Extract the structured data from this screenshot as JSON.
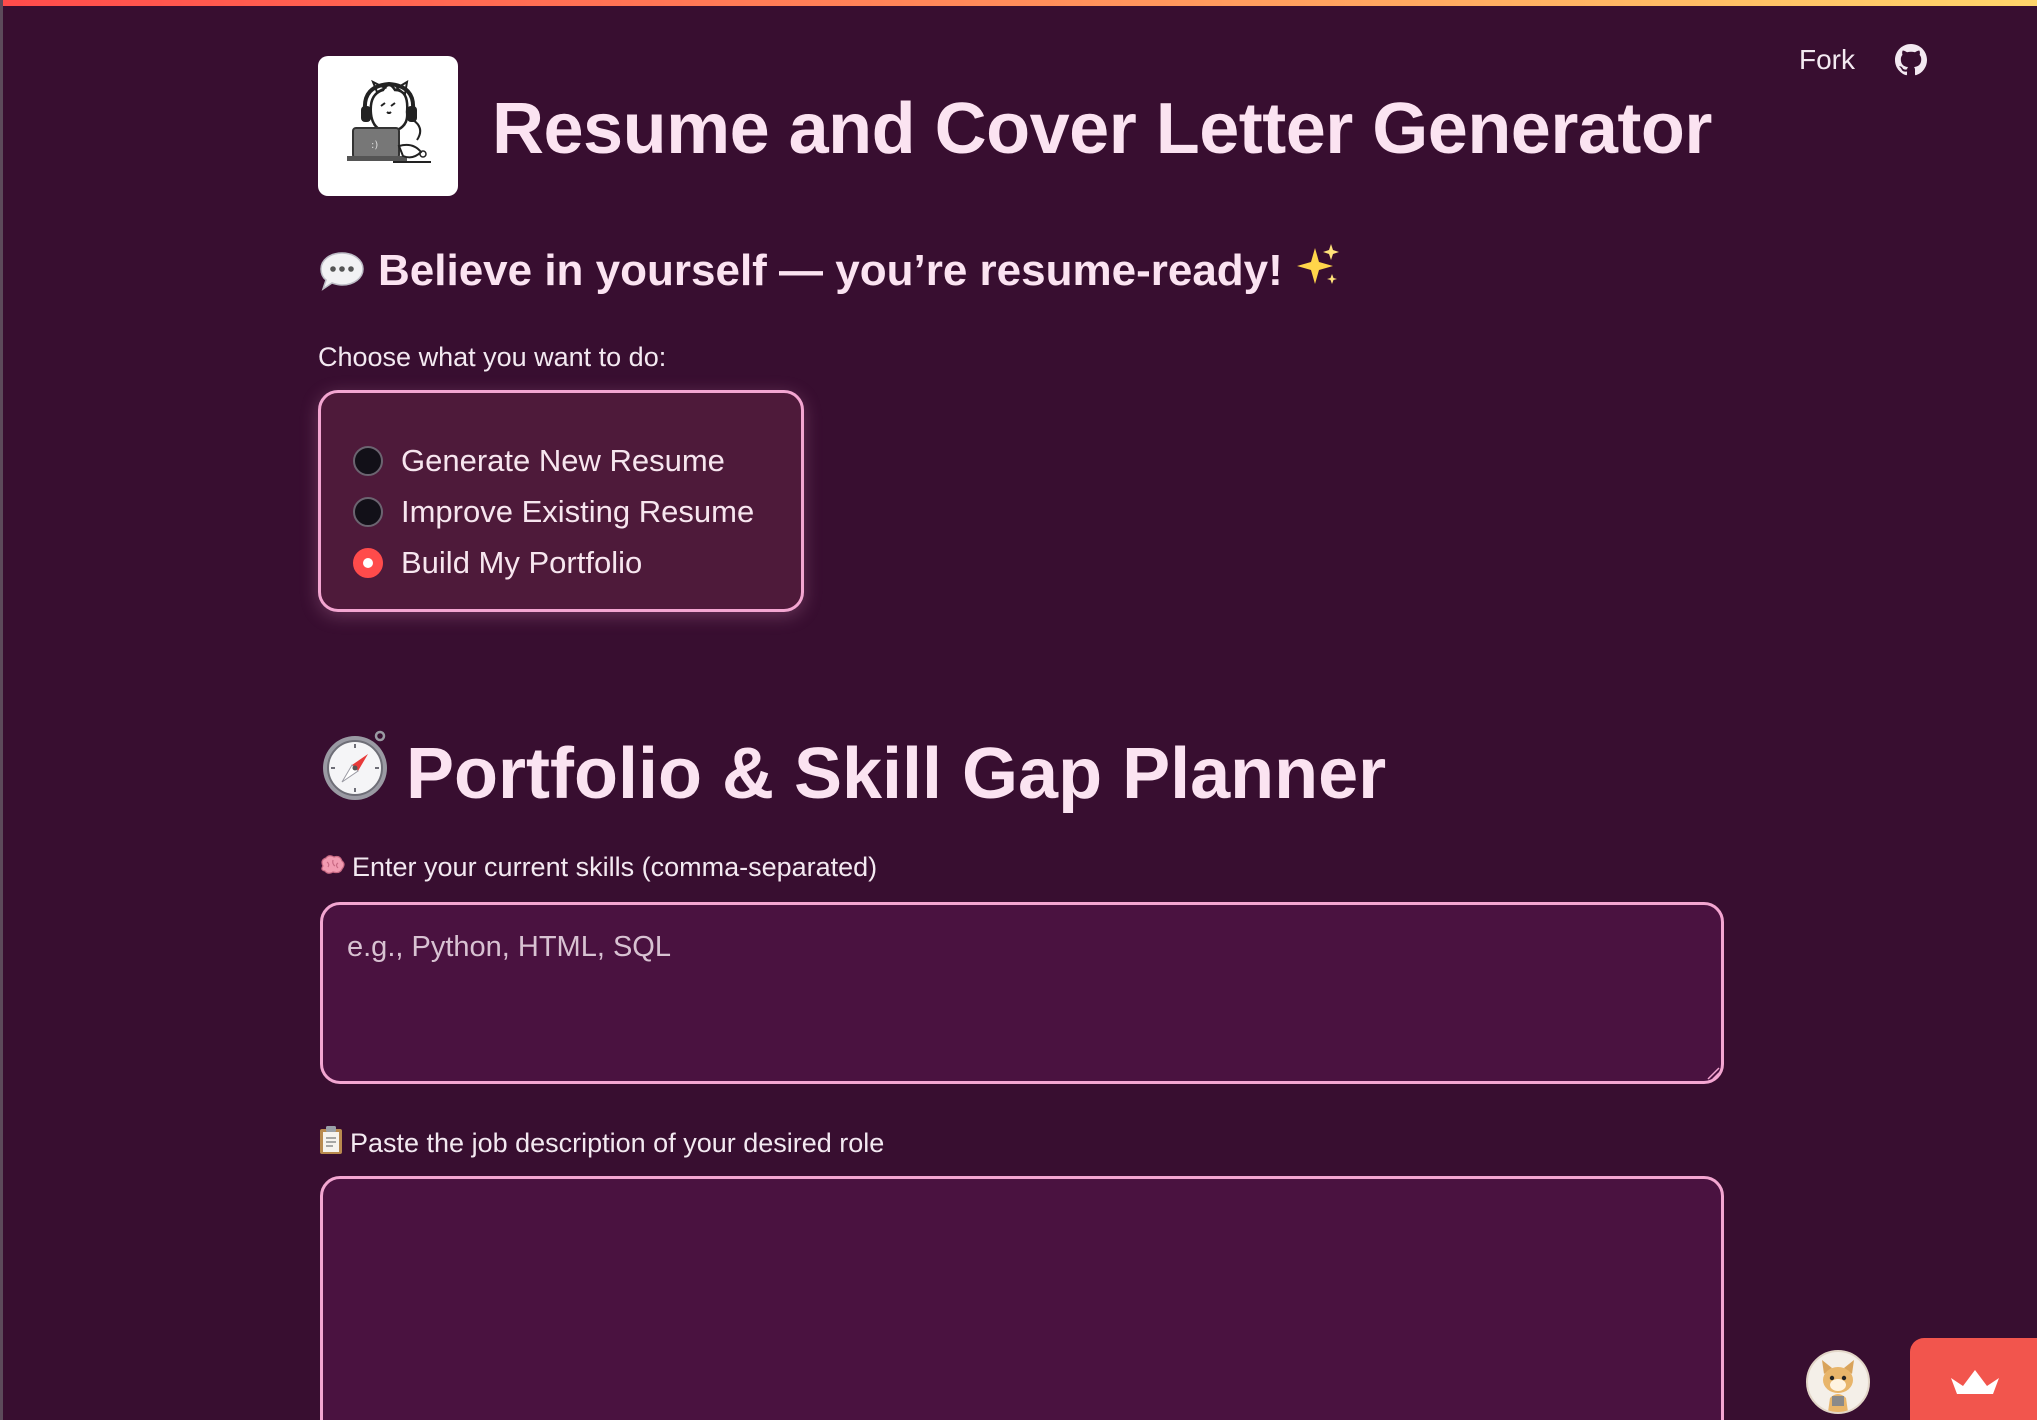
{
  "header": {
    "fork_label": "Fork",
    "github_icon": "github-icon"
  },
  "app": {
    "title": "Resume and Cover Letter Generator",
    "logo_icon": "cat-with-headphones-laptop-logo"
  },
  "motivation": {
    "emoji_left": "speech-bubble-icon",
    "text": "Believe in yourself — you’re resume-ready!",
    "emoji_right": "✨"
  },
  "mode_selector": {
    "label": "Choose what you want to do:",
    "options": [
      {
        "label": "Generate New Resume",
        "selected": false
      },
      {
        "label": "Improve Existing Resume",
        "selected": false
      },
      {
        "label": "Build My Portfolio",
        "selected": true
      }
    ]
  },
  "planner": {
    "title": "Portfolio & Skill Gap Planner",
    "title_icon": "compass-icon",
    "skills": {
      "label": "Enter your current skills (comma-separated)",
      "icon": "brain-icon",
      "value": "",
      "placeholder": "e.g., Python, HTML, SQL"
    },
    "job_description": {
      "label": "Paste the job description of your desired role",
      "icon": "clipboard-icon",
      "value": "",
      "placeholder": ""
    }
  },
  "footer": {
    "avatar_icon": "cat-avatar",
    "badge_icon": "crown-icon"
  },
  "colors": {
    "background": "#380e30",
    "accent_pink": "#f3a6d1",
    "radio_selected": "#ff4b4b",
    "badge": "#f2554d",
    "title_text": "#fbe3f1"
  }
}
